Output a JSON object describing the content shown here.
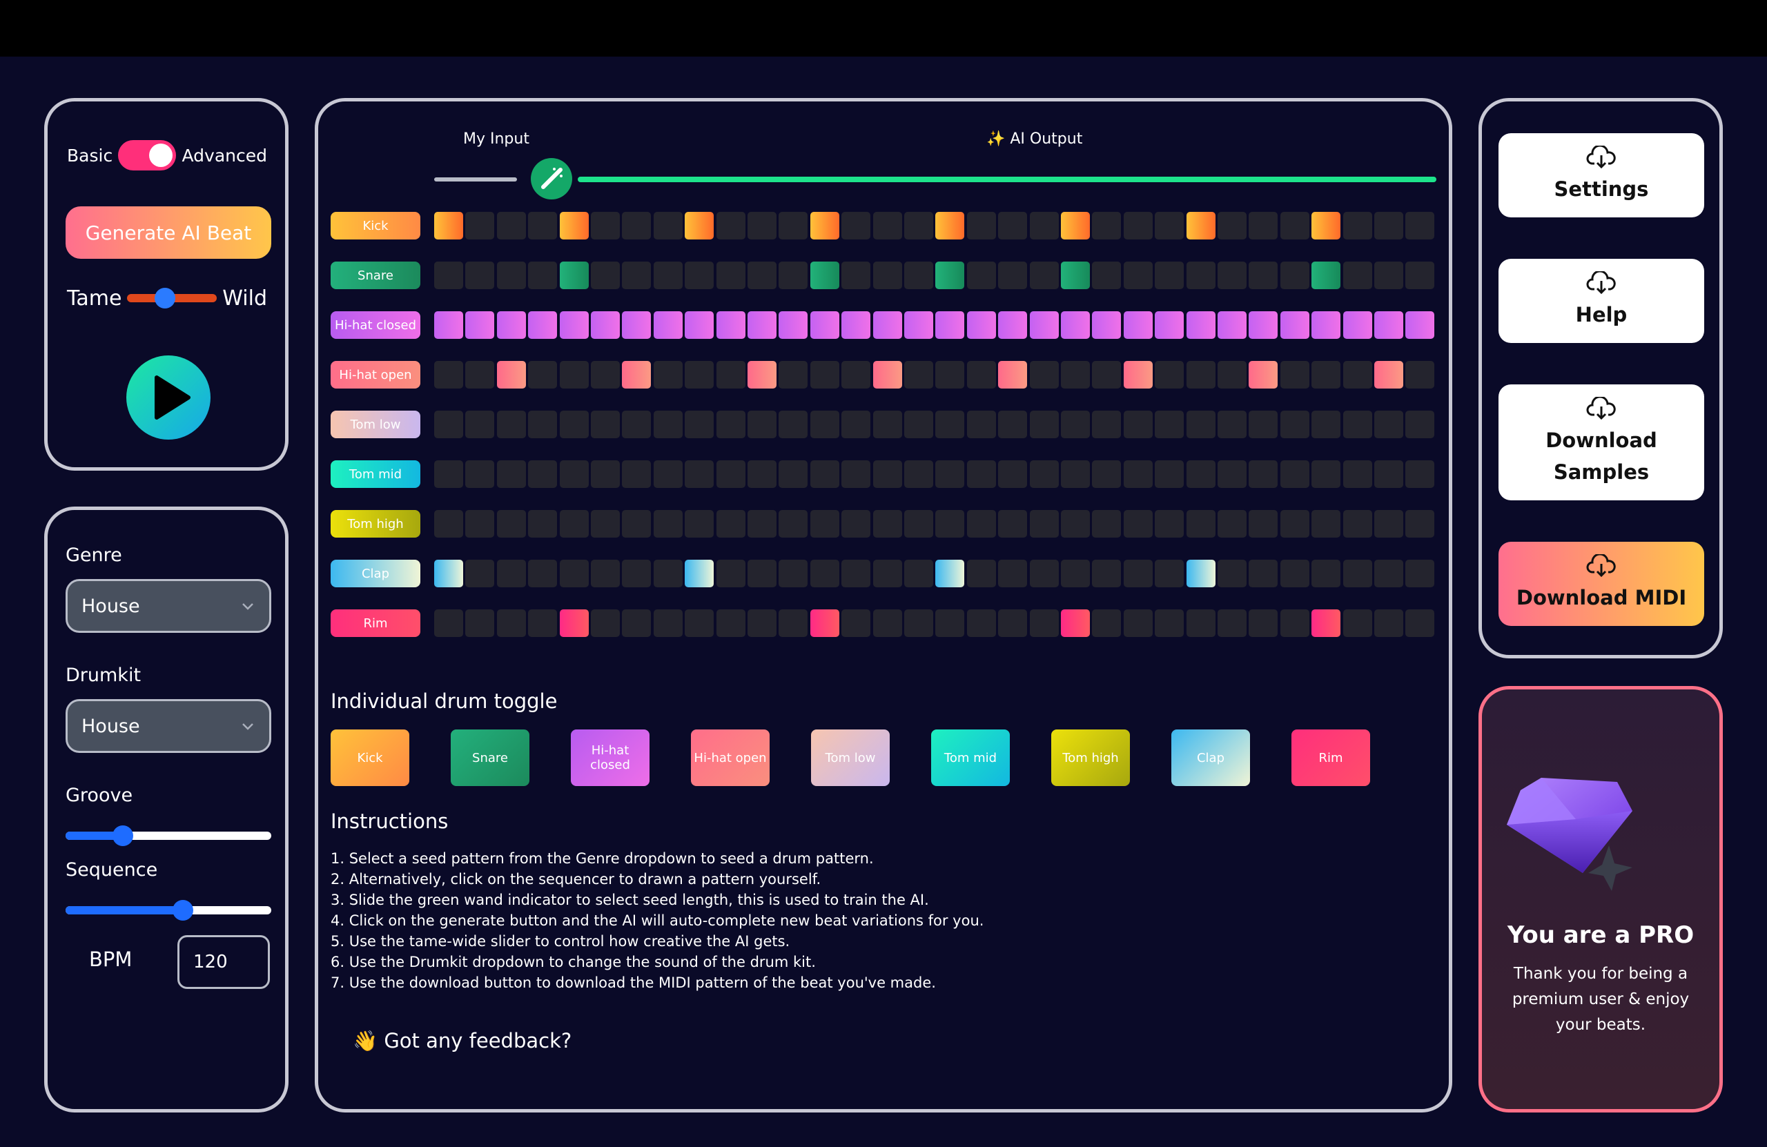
{
  "controls": {
    "mode_basic": "Basic",
    "mode_advanced": "Advanced",
    "mode_advanced_on": true,
    "generate_label": "Generate AI Beat",
    "tame_label": "Tame",
    "wild_label": "Wild",
    "tame_wild_value": 0.42,
    "play_icon": "play-icon"
  },
  "settings": {
    "genre_label": "Genre",
    "genre_value": "House",
    "drumkit_label": "Drumkit",
    "drumkit_value": "House",
    "groove_label": "Groove",
    "groove_value": 0.28,
    "sequence_label": "Sequence",
    "sequence_value": 0.57,
    "bpm_label": "BPM",
    "bpm_value": "120"
  },
  "sequencer": {
    "my_input_label": "My Input",
    "ai_output_label": "✨ AI Output",
    "steps": 32,
    "seed_fraction": 0.09,
    "tracks": [
      {
        "name": "Kick",
        "label_gradient": [
          "#ffc23a",
          "#ff8a45"
        ],
        "on_colors": [
          "#ffc23a",
          "#ff6a2a"
        ],
        "active": [
          0,
          4,
          8,
          12,
          16,
          20,
          24,
          28
        ]
      },
      {
        "name": "Snare",
        "label_gradient": [
          "#23b07c",
          "#1c8a5c"
        ],
        "on_colors": [
          "#22b27a",
          "#178a5a"
        ],
        "active": [
          4,
          12,
          16,
          20,
          28
        ]
      },
      {
        "name": "Hi-hat closed",
        "label_gradient": [
          "#b85cf0",
          "#ee6ee8"
        ],
        "on_colors": [
          "#c462f2",
          "#f071e8"
        ],
        "active": [
          0,
          1,
          2,
          3,
          4,
          5,
          6,
          7,
          8,
          9,
          10,
          11,
          12,
          13,
          14,
          15,
          16,
          17,
          18,
          19,
          20,
          21,
          22,
          23,
          24,
          25,
          26,
          27,
          28,
          29,
          30,
          31
        ]
      },
      {
        "name": "Hi-hat open",
        "label_gradient": [
          "#ff6e8a",
          "#fa8f7e"
        ],
        "on_colors": [
          "#ff6a8a",
          "#fb9a84"
        ],
        "active": [
          2,
          6,
          10,
          14,
          18,
          22,
          26,
          30
        ]
      },
      {
        "name": "Tom low",
        "label_gradient": [
          "#f6c5b0",
          "#c9b7ee"
        ],
        "on_colors": [
          "#f6c5b0",
          "#c9b7ee"
        ],
        "active": []
      },
      {
        "name": "Tom mid",
        "label_gradient": [
          "#1ef0c0",
          "#13b8e0"
        ],
        "on_colors": [
          "#1ef0c0",
          "#13b8e0"
        ],
        "active": []
      },
      {
        "name": "Tom high",
        "label_gradient": [
          "#ece10c",
          "#a7a80e"
        ],
        "on_colors": [
          "#ece10c",
          "#a7a80e"
        ],
        "active": []
      },
      {
        "name": "Clap",
        "label_gradient": [
          "#3cb8f0",
          "#f0f4d6"
        ],
        "on_colors": [
          "#3cb8f0",
          "#eef5d8"
        ],
        "active": [
          0,
          8,
          16,
          24
        ]
      },
      {
        "name": "Rim",
        "label_gradient": [
          "#ff2f7c",
          "#ff4f6a"
        ],
        "on_colors": [
          "#ff2a86",
          "#ff5a62"
        ],
        "active": [
          4,
          12,
          20,
          28
        ]
      }
    ]
  },
  "drum_toggle": {
    "title": "Individual drum toggle",
    "buttons": [
      "Kick",
      "Snare",
      "Hi-hat closed",
      "Hi-hat open",
      "Tom low",
      "Tom mid",
      "Tom high",
      "Clap",
      "Rim"
    ]
  },
  "instructions": {
    "title": "Instructions",
    "items": [
      "1. Select a seed pattern from the Genre dropdown to seed a drum pattern.",
      "2. Alternatively, click on the sequencer to drawn a pattern yourself.",
      "3. Slide the green wand indicator to select seed length, this is used to train the AI.",
      "4. Click on the generate button and the AI will auto-complete new beat variations for you.",
      "5. Use the tame-wide slider to control how creative the AI gets.",
      "6. Use the Drumkit dropdown to change the sound of the drum kit.",
      "7. Use the download button to download the MIDI pattern of the beat you've made."
    ]
  },
  "feedback": "👋 Got any feedback?",
  "actions": {
    "settings": "Settings",
    "help": "Help",
    "download_samples_line1": "Download",
    "download_samples_line2": "Samples",
    "download_midi": "Download MIDI",
    "icon": "cloud-download-icon"
  },
  "pro": {
    "title": "You are a PRO",
    "text": "Thank you for being a premium user & enjoy your beats.",
    "icon": "diamond-icon"
  },
  "colors": {
    "background": "#0a0a28",
    "panel_border": "#c8c8d4",
    "accent_green": "#1de38c",
    "accent_pink": "#ff2f7a",
    "accent_blue": "#1e6cff"
  }
}
